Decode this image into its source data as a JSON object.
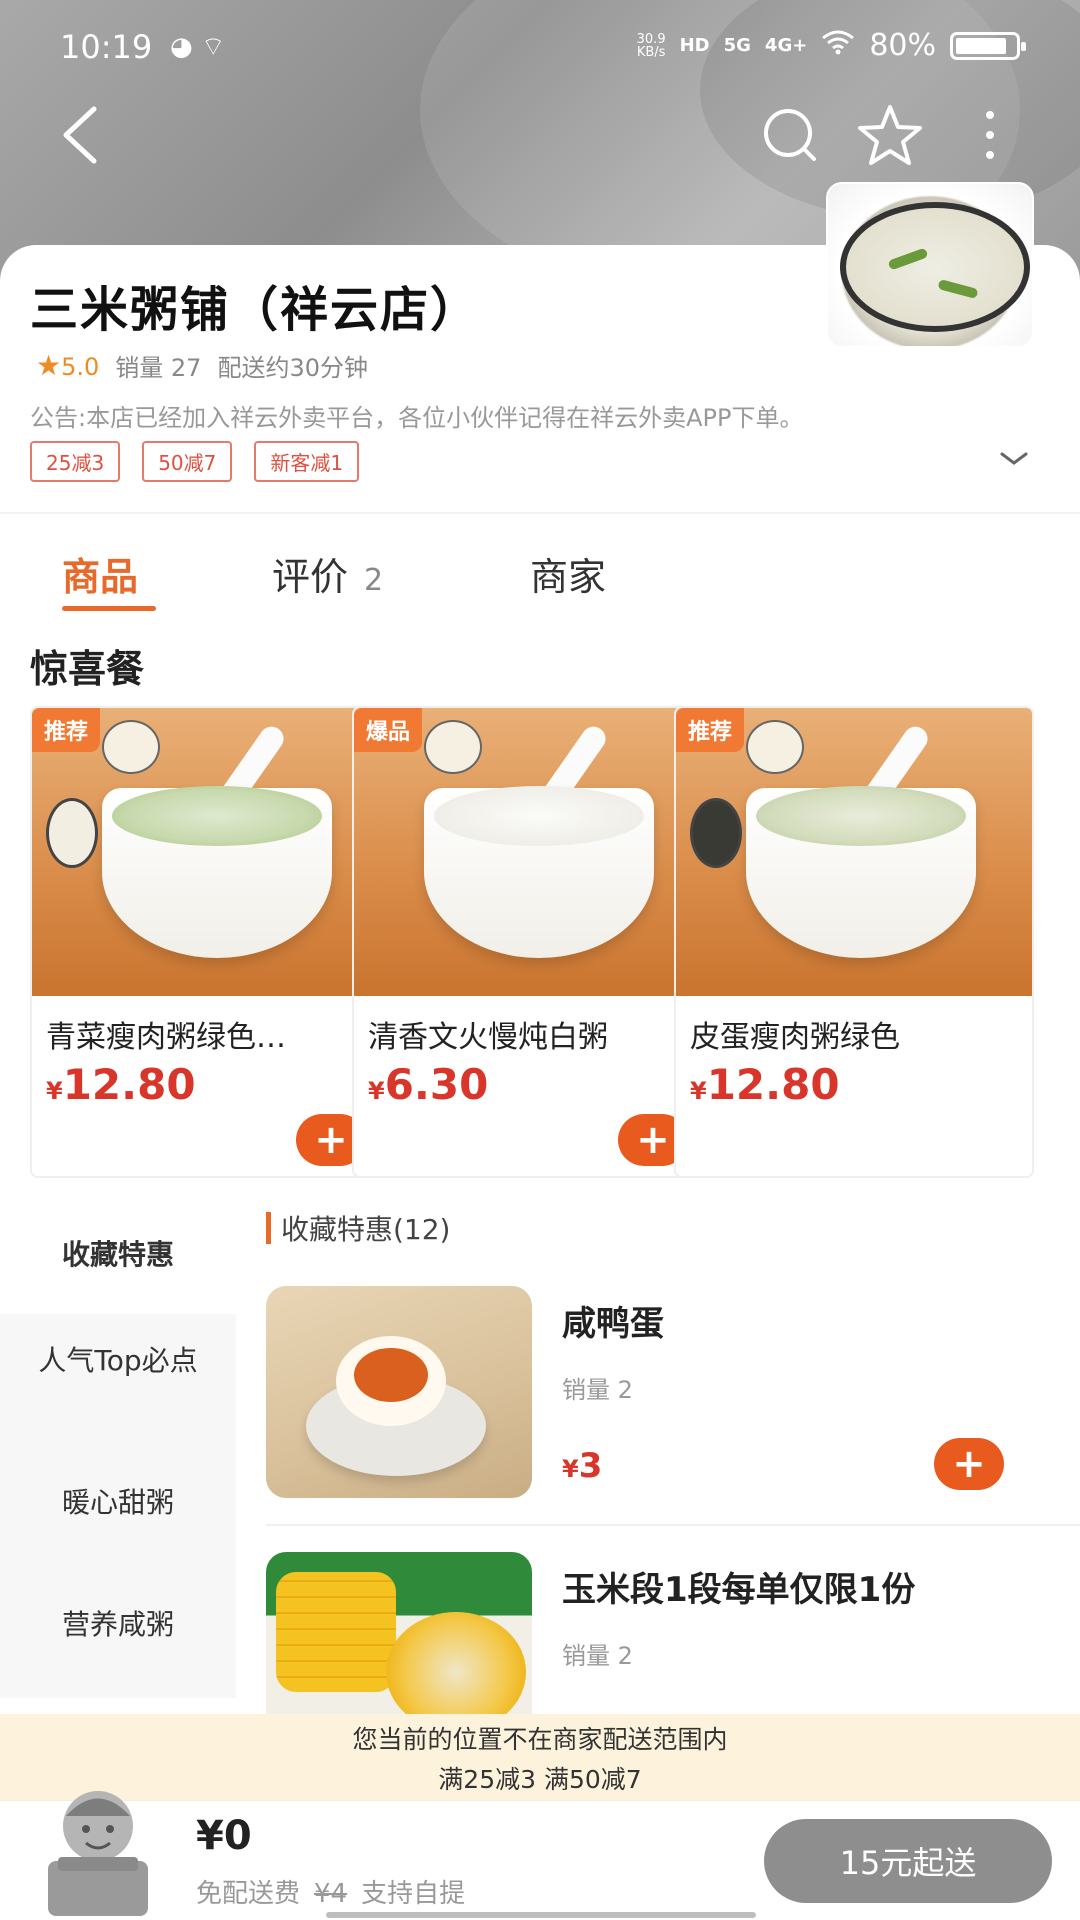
{
  "status_bar": {
    "time": "10:19",
    "net_speed_value": "30.9",
    "net_speed_unit": "KB/s",
    "hd": "HD",
    "net_5g": "5G",
    "net_4g": "4G+",
    "battery": "80%"
  },
  "store": {
    "name": "三米粥铺（祥云店）",
    "rating": "5.0",
    "sales": "销量 27",
    "delivery_time": "配送约30分钟",
    "notice": "公告:本店已经加入祥云外卖平台，各位小伙伴记得在祥云外卖APP下单。",
    "promos": [
      "25减3",
      "50减7",
      "新客减1"
    ]
  },
  "tabs": {
    "goods": "商品",
    "reviews": "评价",
    "reviews_count": "2",
    "store": "商家"
  },
  "featured": {
    "title": "惊喜餐",
    "items": [
      {
        "badge": "推荐",
        "name": "青菜瘦肉粥绿色…",
        "currency": "¥",
        "price": "12.80"
      },
      {
        "badge": "爆品",
        "name": "清香文火慢炖白粥",
        "currency": "¥",
        "price": "6.30"
      },
      {
        "badge": "推荐",
        "name": "皮蛋瘦肉粥绿色",
        "currency": "¥",
        "price": "12.80"
      }
    ]
  },
  "categories": [
    "收藏特惠",
    "人气Top必点",
    "暖心甜粥",
    "营养咸粥"
  ],
  "category_header": "收藏特惠(12)",
  "products": [
    {
      "name": "咸鸭蛋",
      "sales": "销量 2",
      "currency": "¥",
      "price": "3"
    },
    {
      "name": "玉米段1段每单仅限1份",
      "sales": "销量 2"
    }
  ],
  "range_notice": {
    "line1": "您当前的位置不在商家配送范围内",
    "line2": "满25减3  满50减7"
  },
  "cart": {
    "total": "¥0",
    "free_delivery": "免配送费",
    "original_fee": "¥4",
    "pickup": "支持自提",
    "checkout": "15元起送"
  },
  "colors": {
    "accent": "#e86a2a",
    "price": "#d8362a",
    "add_button": "#e85a1e",
    "notice_bg": "#fdf3dc",
    "checkout_disabled": "#8e8e8e"
  }
}
